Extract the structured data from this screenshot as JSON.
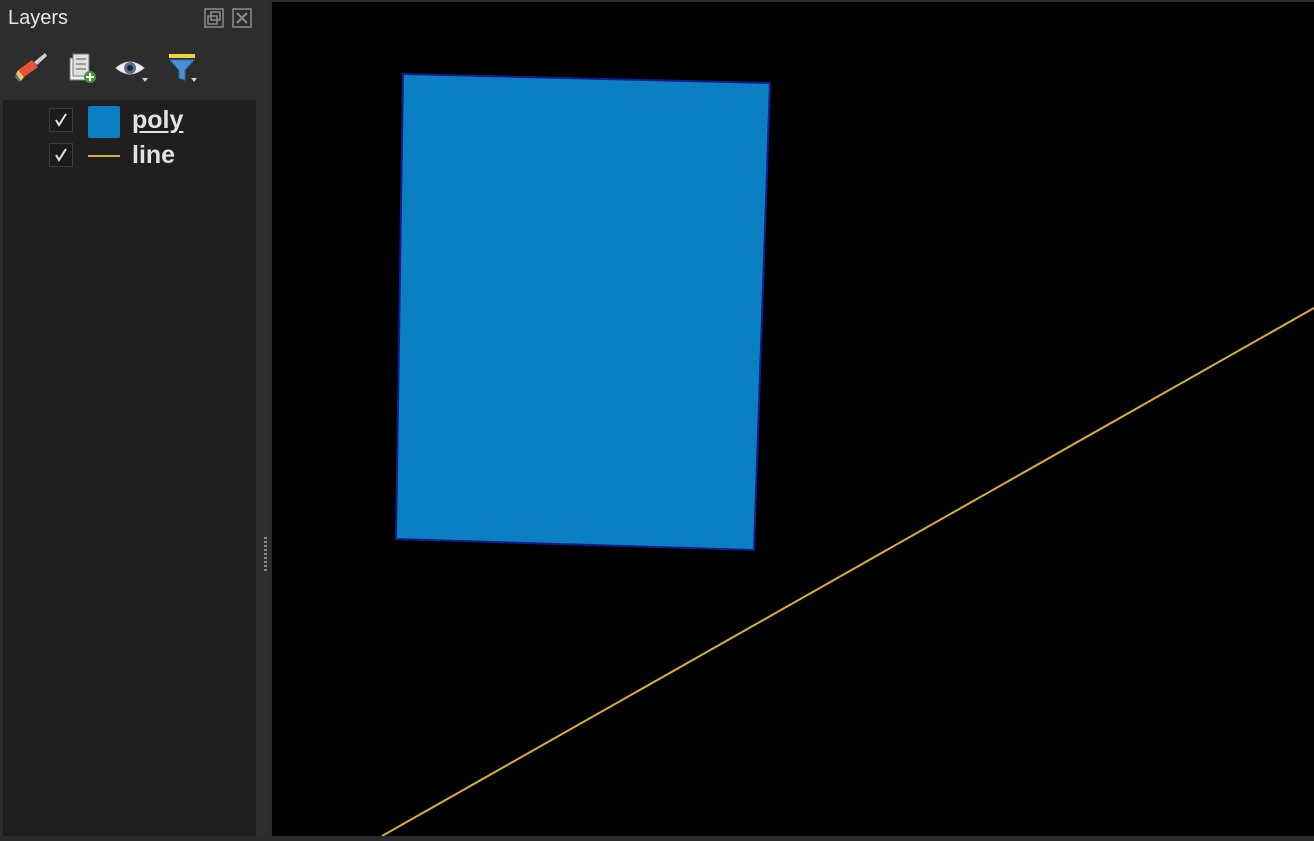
{
  "panel": {
    "title": "Layers",
    "icons": {
      "float": "float-panel-icon",
      "close": "close-panel-icon",
      "style": "paintbrush-icon",
      "add_group": "add-group-icon",
      "visibility": "eye-icon",
      "filter": "filter-icon"
    }
  },
  "layers": [
    {
      "name": "poly",
      "checked": true,
      "type": "polygon",
      "color": "#0a80c2",
      "selected": true
    },
    {
      "name": "line",
      "checked": true,
      "type": "line",
      "color": "#d9b02a",
      "selected": false
    }
  ],
  "map": {
    "background": "#000000",
    "polygon_fill": "#0a80c2",
    "polygon_stroke": "#1a1a8c",
    "line_color": "#d9b02a"
  }
}
